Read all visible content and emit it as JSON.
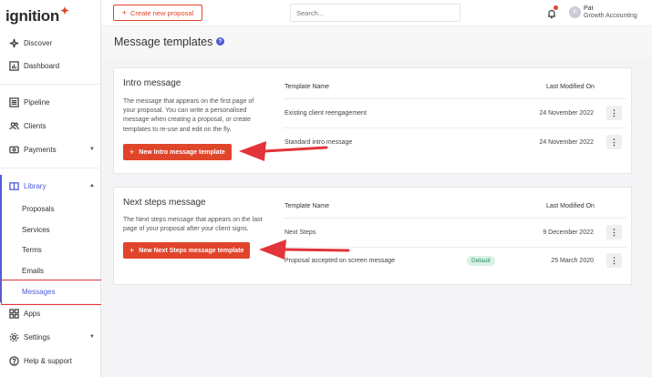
{
  "sidebar": {
    "logo": "ignition",
    "items": [
      {
        "label": "Discover",
        "icon": "sparkle-icon"
      },
      {
        "label": "Dashboard",
        "icon": "bar-chart-icon"
      },
      {
        "label": "Pipeline",
        "icon": "list-icon"
      },
      {
        "label": "Clients",
        "icon": "users-icon"
      },
      {
        "label": "Payments",
        "icon": "payment-icon"
      },
      {
        "label": "Library",
        "icon": "book-icon"
      },
      {
        "label": "Apps",
        "icon": "grid-icon"
      },
      {
        "label": "Settings",
        "icon": "gear-icon"
      },
      {
        "label": "Help & support",
        "icon": "help-icon"
      }
    ],
    "library_sub": [
      "Proposals",
      "Services",
      "Terms",
      "Emails",
      "Messages"
    ]
  },
  "topbar": {
    "create_label": "Create new proposal",
    "search_placeholder": "Search...",
    "user_initial": "P",
    "user_name": "Pat",
    "user_org": "Growth Accounting"
  },
  "page": {
    "title": "Message templates",
    "help": "?"
  },
  "intro": {
    "title": "Intro message",
    "desc_lines": [
      "The message that appears on the first page of",
      "your proposal. You can write a personalised",
      "message when creating a proposal, or create",
      "templates to re-use and edit on the fly."
    ],
    "button": "New Intro message template",
    "col_name": "Template Name",
    "col_modified": "Last Modified On",
    "rows": [
      {
        "name": "Existing client reengagement",
        "date": "24 November 2022"
      },
      {
        "name": "Standard intro message",
        "date": "24 November 2022"
      }
    ]
  },
  "next": {
    "title": "Next steps message",
    "desc_lines": [
      "The Next steps message that appears on the last",
      "page of your proposal after your client signs."
    ],
    "button": "New Next Steps message template",
    "col_name": "Template Name",
    "col_modified": "Last Modified On",
    "rows": [
      {
        "name": "Next Steps",
        "date": "9 December 2022",
        "badge": ""
      },
      {
        "name": "Proposal accepted on screen message",
        "date": "25 March 2020",
        "badge": "Default"
      }
    ]
  },
  "kebab": "⋮",
  "colors": {
    "brand": "#e0452b",
    "accent": "#4f5dd6",
    "annotation": "#e2343a"
  }
}
